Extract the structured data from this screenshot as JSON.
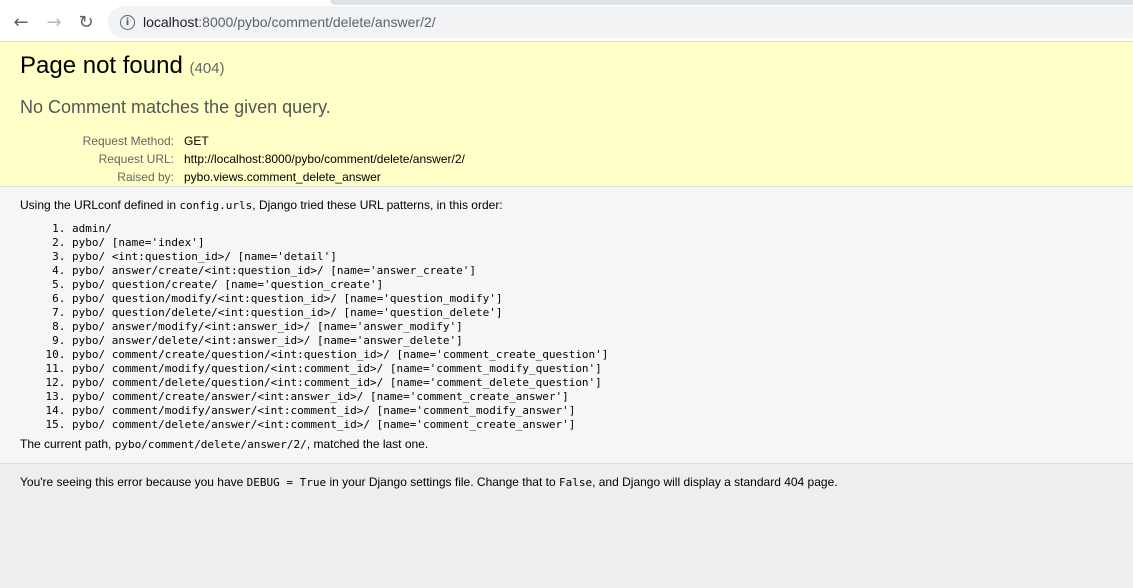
{
  "browser": {
    "url_host": "localhost",
    "url_path": ":8000/pybo/comment/delete/answer/2/"
  },
  "summary": {
    "title": "Page not found",
    "status_code": "(404)",
    "exception": "No Comment matches the given query.",
    "meta": [
      {
        "label": "Request Method:",
        "value": "GET"
      },
      {
        "label": "Request URL:",
        "value": "http://localhost:8000/pybo/comment/delete/answer/2/"
      },
      {
        "label": "Raised by:",
        "value": "pybo.views.comment_delete_answer"
      }
    ]
  },
  "info": {
    "intro_prefix": "Using the URLconf defined in ",
    "intro_code": "config.urls",
    "intro_suffix": ", Django tried these URL patterns, in this order:",
    "patterns": [
      "admin/",
      "pybo/ [name='index']",
      "pybo/ <int:question_id>/ [name='detail']",
      "pybo/ answer/create/<int:question_id>/ [name='answer_create']",
      "pybo/ question/create/ [name='question_create']",
      "pybo/ question/modify/<int:question_id>/ [name='question_modify']",
      "pybo/ question/delete/<int:question_id>/ [name='question_delete']",
      "pybo/ answer/modify/<int:answer_id>/ [name='answer_modify']",
      "pybo/ answer/delete/<int:answer_id>/ [name='answer_delete']",
      "pybo/ comment/create/question/<int:question_id>/ [name='comment_create_question']",
      "pybo/ comment/modify/question/<int:comment_id>/ [name='comment_modify_question']",
      "pybo/ comment/delete/question/<int:comment_id>/ [name='comment_delete_question']",
      "pybo/ comment/create/answer/<int:answer_id>/ [name='comment_create_answer']",
      "pybo/ comment/modify/answer/<int:comment_id>/ [name='comment_modify_answer']",
      "pybo/ comment/delete/answer/<int:comment_id>/ [name='comment_create_answer']"
    ],
    "current_prefix": "The current path, ",
    "current_path": "pybo/comment/delete/answer/2/",
    "current_suffix": ", matched the last one."
  },
  "explanation": {
    "prefix": "You're seeing this error because you have ",
    "debug_code": "DEBUG = True",
    "middle": " in your Django settings file. Change that to ",
    "false_code": "False",
    "suffix": ", and Django will display a standard 404 page."
  }
}
